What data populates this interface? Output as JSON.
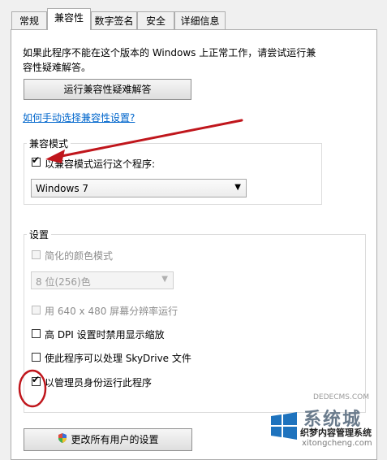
{
  "tabs": [
    {
      "label": "常规"
    },
    {
      "label": "兼容性"
    },
    {
      "label": "数字签名"
    },
    {
      "label": "安全"
    },
    {
      "label": "详细信息"
    }
  ],
  "intro_text_line1": "如果此程序不能在这个版本的 Windows 上正常工作，请尝试运行兼",
  "intro_text_line2": "容性疑难解答。",
  "troubleshooter_button": "运行兼容性疑难解答",
  "manual_link": "如何手动选择兼容性设置?",
  "compat_mode": {
    "legend": "兼容模式",
    "checkbox_label": "以兼容模式运行这个程序:",
    "checked": true,
    "selected_os": "Windows 7"
  },
  "settings": {
    "legend": "设置",
    "reduced_color_label": "简化的颜色模式",
    "color_select_value": "8 位(256)色",
    "res_640_label": "用 640 x 480 屏幕分辨率运行",
    "high_dpi_label": "高 DPI 设置时禁用显示缩放",
    "skydrive_label": "使此程序可以处理 SkyDrive 文件",
    "admin_label": "以管理员身份运行此程序",
    "admin_checked": true
  },
  "all_users_button": "更改所有用户的设置",
  "watermark": {
    "site1": "DEDECMS.COM",
    "brand": "系统城",
    "site2": "xitongcheng.com",
    "tagline": "织梦内容管理系统"
  },
  "colors": {
    "link": "#0066cc",
    "annotation_red": "#c0161c"
  }
}
